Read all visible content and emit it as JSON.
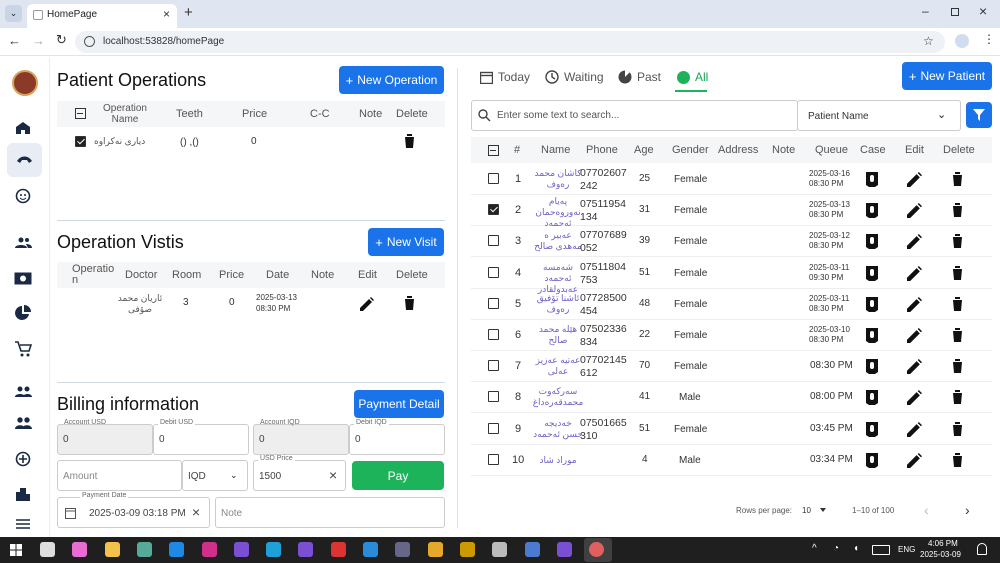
{
  "browser": {
    "tab_title": "HomePage",
    "url": "localhost:53828/homePage"
  },
  "patient_ops": {
    "title": "Patient Operations",
    "new_btn": "New Operation",
    "headers": [
      "Operation Name",
      "Teeth",
      "Price",
      "C-C",
      "Note",
      "Delete"
    ],
    "row": {
      "name": "دیاری نەکراوە",
      "teeth": "() ,()",
      "price": "0"
    }
  },
  "visits": {
    "title": "Operation Vistis",
    "new_btn": "New Visit",
    "headers": [
      "Operatio n",
      "Doctor",
      "Room",
      "Price",
      "Date",
      "Note",
      "Edit",
      "Delete"
    ],
    "row": {
      "doctor": "ئاریان محمد صۆفی",
      "room": "3",
      "price": "0",
      "date": "2025-03-13",
      "time": "08:30 PM"
    }
  },
  "billing": {
    "title": "Billing information",
    "detail_btn": "Payment Detail",
    "account_usd_label": "Account USD",
    "account_usd": "0",
    "debit_usd_label": "Debit USD",
    "debit_usd": "0",
    "account_iqd_label": "Account IQD",
    "account_iqd": "0",
    "debit_iqd_label": "Debit IQD",
    "debit_iqd": "0",
    "amount_ph": "Amount",
    "currency": "IQD",
    "usd_price_label": "USD Price",
    "usd_price": "1500",
    "pay_btn": "Pay",
    "payment_date_label": "Payment Date",
    "payment_date": "2025-03-09 03:18 PM",
    "note_ph": "Note"
  },
  "filters": {
    "today": "Today",
    "waiting": "Waiting",
    "past": "Past",
    "all": "All",
    "new_patient": "New Patient",
    "search_ph": "Enter some text to search...",
    "search_by": "Patient Name"
  },
  "table": {
    "headers": [
      "#",
      "Name",
      "Phone",
      "Age",
      "Gender",
      "Address",
      "Note",
      "Queue",
      "Case",
      "Edit",
      "Delete"
    ],
    "rows": [
      {
        "n": "1",
        "name1": "کاشان محمد",
        "name2": "رەوف",
        "ph1": "07702607",
        "ph2": "242",
        "age": "25",
        "gender": "Female",
        "q1": "2025-03-16",
        "q2": "08:30 PM",
        "checked": false
      },
      {
        "n": "2",
        "name1": "پەیام",
        "name2": "نەوروەحمان",
        "name3": "ئەحمەد",
        "ph1": "07511954",
        "ph2": "134",
        "age": "31",
        "gender": "Female",
        "q1": "2025-03-13",
        "q2": "08:30 PM",
        "checked": true
      },
      {
        "n": "3",
        "name1": "عەبیر ە",
        "name2": "مەهدی صالح",
        "ph1": "07707689",
        "ph2": "052",
        "age": "39",
        "gender": "Female",
        "q1": "2025-03-12",
        "q2": "08:30 PM",
        "checked": false
      },
      {
        "n": "4",
        "name1": "شەمسە ئەحمەد",
        "name2": "عەبدولقادر",
        "ph1": "07511804",
        "ph2": "753",
        "age": "51",
        "gender": "Female",
        "q1": "2025-03-11",
        "q2": "09:30 PM",
        "checked": false
      },
      {
        "n": "5",
        "name1": "ئاشنا تۆفیق",
        "name2": "رەوف",
        "ph1": "07728500",
        "ph2": "454",
        "age": "48",
        "gender": "Female",
        "q1": "2025-03-11",
        "q2": "08:30 PM",
        "checked": false
      },
      {
        "n": "6",
        "name1": "هێلە محمد",
        "name2": "صالح",
        "ph1": "07502336",
        "ph2": "834",
        "age": "22",
        "gender": "Female",
        "q1": "2025-03-10",
        "q2": "08:30 PM",
        "checked": false
      },
      {
        "n": "7",
        "name1": "عەتیە عەزیز",
        "name2": "عەلی",
        "ph1": "07702145",
        "ph2": "612",
        "age": "70",
        "gender": "Female",
        "q1": "",
        "q2": "08:30 PM",
        "checked": false
      },
      {
        "n": "8",
        "name1": "سەرکەوت",
        "name2": "محمدقەرەداغ",
        "ph1": "",
        "ph2": "",
        "age": "41",
        "gender": "Male",
        "q1": "",
        "q2": "08:00 PM",
        "checked": false
      },
      {
        "n": "9",
        "name1": "خەدیجە",
        "name2": "حسن ئەحمەد",
        "ph1": "07501665",
        "ph2": "310",
        "age": "51",
        "gender": "Female",
        "q1": "",
        "q2": "03:45 PM",
        "checked": false
      },
      {
        "n": "10",
        "name1": "موراد شاد",
        "name2": "",
        "ph1": "",
        "ph2": "",
        "age": "4",
        "gender": "Male",
        "q1": "",
        "q2": "03:34 PM",
        "checked": false
      }
    ]
  },
  "pager": {
    "rows_label": "Rows per page:",
    "rows_value": "10",
    "range": "1–10 of 100"
  },
  "taskbar": {
    "time": "4:06 PM",
    "date": "2025-03-09",
    "lang": "ENG"
  }
}
